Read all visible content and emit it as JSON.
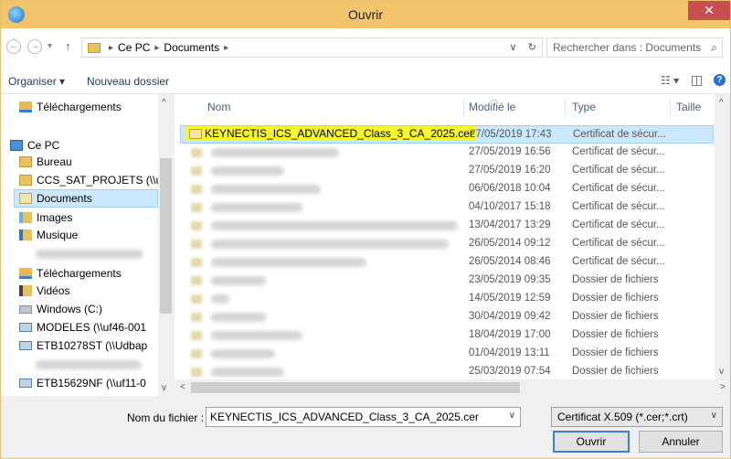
{
  "window": {
    "title": "Ouvrir",
    "close_glyph": "✕"
  },
  "address": {
    "back_glyph": "←",
    "forward_glyph": "→",
    "recent_glyph": "▾",
    "up_glyph": "↑",
    "crumbs": [
      "Ce PC",
      "Documents"
    ],
    "crumb_sep": "▸",
    "dropdown_glyph": "∨",
    "refresh_glyph": "↻",
    "search_placeholder": "Rechercher dans : Documents",
    "search_glyph": "⌕"
  },
  "toolbar": {
    "organize_label": "Organiser ▾",
    "new_folder_label": "Nouveau dossier",
    "view_glyph": "☷ ▾",
    "pane_glyph": "◫",
    "help_glyph": "?"
  },
  "nav": {
    "items": [
      {
        "label": "Téléchargements",
        "icon": "download-icon"
      },
      {
        "label": "Ce PC",
        "icon": "computer-icon"
      },
      {
        "label": "Bureau",
        "icon": "folder-icon"
      },
      {
        "label": "CCS_SAT_PROJETS (\\\\uf",
        "icon": "folder-icon"
      },
      {
        "label": "Documents",
        "icon": "documents-icon"
      },
      {
        "label": "Images",
        "icon": "images-icon"
      },
      {
        "label": "Musique",
        "icon": "music-icon"
      },
      {
        "label": "Téléchargements",
        "icon": "download-icon"
      },
      {
        "label": "Vidéos",
        "icon": "video-icon"
      },
      {
        "label": "Windows (C:)",
        "icon": "drive-icon"
      },
      {
        "label": "MODELES (\\\\uf46-001",
        "icon": "network-drive-icon"
      },
      {
        "label": "ETB10278ST (\\\\Udbap",
        "icon": "network-drive-icon"
      },
      {
        "label": "ETB15629NF (\\\\uf11-0",
        "icon": "network-drive-icon"
      }
    ]
  },
  "list": {
    "columns": {
      "name": "Nom",
      "modified": "Modifié le",
      "type": "Type",
      "size": "Taille"
    },
    "rows": [
      {
        "name": "KEYNECTIS_ICS_ADVANCED_Class_3_CA_2025.cer",
        "modified": "27/05/2019 17:43",
        "type": "Certificat de sécur..."
      },
      {
        "name": "",
        "modified": "27/05/2019 16:56",
        "type": "Certificat de sécur..."
      },
      {
        "name": "",
        "modified": "27/05/2019 16:20",
        "type": "Certificat de sécur..."
      },
      {
        "name": "",
        "modified": "06/06/2018 10:04",
        "type": "Certificat de sécur..."
      },
      {
        "name": "",
        "modified": "04/10/2017 15:18",
        "type": "Certificat de sécur..."
      },
      {
        "name": "",
        "modified": "13/04/2017 13:29",
        "type": "Certificat de sécur..."
      },
      {
        "name": "",
        "modified": "26/05/2014 09:12",
        "type": "Certificat de sécur..."
      },
      {
        "name": "",
        "modified": "26/05/2014 08:46",
        "type": "Certificat de sécur..."
      },
      {
        "name": "",
        "modified": "23/05/2019 09:35",
        "type": "Dossier de fichiers"
      },
      {
        "name": "",
        "modified": "14/05/2019 12:59",
        "type": "Dossier de fichiers"
      },
      {
        "name": "",
        "modified": "30/04/2019 09:42",
        "type": "Dossier de fichiers"
      },
      {
        "name": "",
        "modified": "18/04/2019 17:00",
        "type": "Dossier de fichiers"
      },
      {
        "name": "",
        "modified": "01/04/2019 13:11",
        "type": "Dossier de fichiers"
      },
      {
        "name": "",
        "modified": "25/03/2019 07:54",
        "type": "Dossier de fichiers"
      }
    ]
  },
  "footer": {
    "filename_label": "Nom du fichier :",
    "filename_value": "KEYNECTIS_ICS_ADVANCED_Class_3_CA_2025.cer",
    "filename_dd_glyph": "∨",
    "filter_value": "Certificat X.509 (*.cer;*.crt)",
    "filter_dd_glyph": "∨",
    "open_label": "Ouvrir",
    "cancel_label": "Annuler"
  },
  "colors": {
    "titlebar": "#f2c46c",
    "selection": "#cce8ff",
    "close": "#c74f4f"
  }
}
